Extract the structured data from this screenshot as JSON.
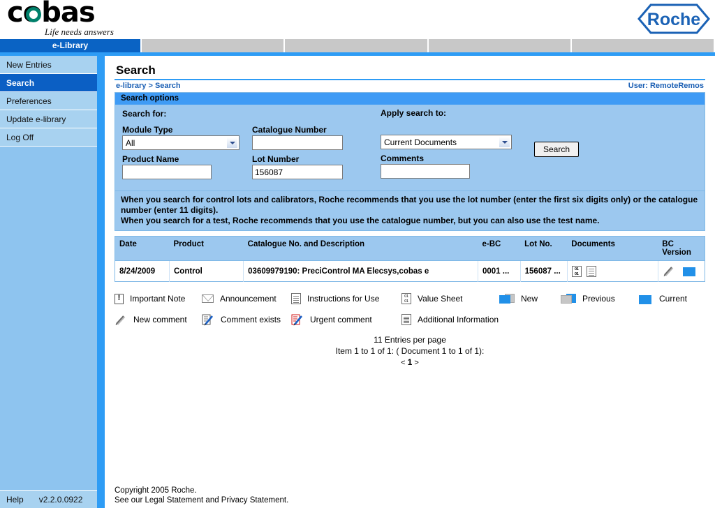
{
  "brand": {
    "logo_text": "cobas",
    "tagline": "Life needs answers",
    "roche_text": "Roche"
  },
  "nav": {
    "tabs": [
      {
        "label": "e-Library",
        "active": true
      },
      {
        "label": "",
        "active": false
      },
      {
        "label": "",
        "active": false
      },
      {
        "label": "",
        "active": false
      },
      {
        "label": "",
        "active": false
      }
    ]
  },
  "sidebar": {
    "items": [
      {
        "label": "New Entries",
        "active": false
      },
      {
        "label": "Search",
        "active": true
      },
      {
        "label": "Preferences",
        "active": false
      },
      {
        "label": "Update e-library",
        "active": false
      },
      {
        "label": "Log Off",
        "active": false
      }
    ],
    "help_label": "Help",
    "version": "v2.2.0.0922"
  },
  "header": {
    "title": "Search",
    "breadcrumb": "e-library > Search",
    "user": "User: RemoteRemos"
  },
  "search_panel": {
    "panel_title": "Search options",
    "search_for_label": "Search for:",
    "apply_to_label": "Apply search to:",
    "module_type_label": "Module Type",
    "module_type_value": "All",
    "product_name_label": "Product Name",
    "product_name_value": "",
    "product_name_placeholder": "",
    "catalogue_number_label": "Catalogue Number",
    "catalogue_number_value": "",
    "catalogue_number_placeholder": "",
    "lot_number_label": "Lot Number",
    "lot_number_value": "156087",
    "lot_number_placeholder": "",
    "apply_to_value": "Current Documents",
    "comments_label": "Comments",
    "comments_value": "",
    "comments_placeholder": "",
    "search_button": "Search"
  },
  "hint": {
    "line1": "When you search for control lots and calibrators, Roche recommends that you use the lot number (enter the first six digits only) or the catalogue number (enter 11 digits).",
    "line2": "When you search for a test, Roche recommends that you use the catalogue number, but you can also use the test name."
  },
  "results": {
    "columns": [
      "Date",
      "Product",
      "Catalogue No. and Description",
      "e-BC",
      "Lot No.",
      "Documents",
      "BC Version"
    ],
    "rows": [
      {
        "date": "8/24/2009",
        "product": "Control",
        "description": "03609979190: PreciControl MA Elecsys,cobas e",
        "ebc": "0001 ...",
        "lot": "156087 ...",
        "doc_icons": [
          "value-sheet-icon",
          "instructions-for-use-icon"
        ],
        "comment_icon": "new-comment-icon",
        "bc_version_icon": "current-card-icon"
      }
    ]
  },
  "legend": {
    "row1": [
      {
        "icon": "important-note-icon",
        "label": "Important Note"
      },
      {
        "icon": "announcement-icon",
        "label": "Announcement"
      },
      {
        "icon": "instructions-for-use-icon",
        "label": "Instructions for Use"
      },
      {
        "icon": "value-sheet-icon",
        "label": "Value Sheet"
      },
      {
        "icon": "new-card-icon",
        "label": "New"
      },
      {
        "icon": "previous-card-icon",
        "label": "Previous"
      },
      {
        "icon": "current-card-icon",
        "label": "Current"
      }
    ],
    "row2": [
      {
        "icon": "new-comment-icon",
        "label": "New comment"
      },
      {
        "icon": "comment-exists-icon",
        "label": "Comment exists"
      },
      {
        "icon": "urgent-comment-icon",
        "label": "Urgent comment"
      },
      {
        "icon": "additional-information-icon",
        "label": "Additional Information"
      }
    ]
  },
  "pager": {
    "entries_per_page": "11 Entries per page",
    "item_range": "Item 1 to 1 of 1:  ( Document 1 to 1 of 1):",
    "prev": "<",
    "current": "1",
    "next": ">"
  },
  "footer": {
    "copyright": "Copyright 2005 Roche.",
    "legal": "See our Legal Statement and Privacy Statement."
  },
  "colors": {
    "accent_blue": "#2e9cf5",
    "nav_active": "#0a63c4",
    "panel_body": "#9cc8ef",
    "sidebar": "#a8d2f0",
    "card_blue": "#2190e8",
    "cobas_green": "#00806b"
  }
}
